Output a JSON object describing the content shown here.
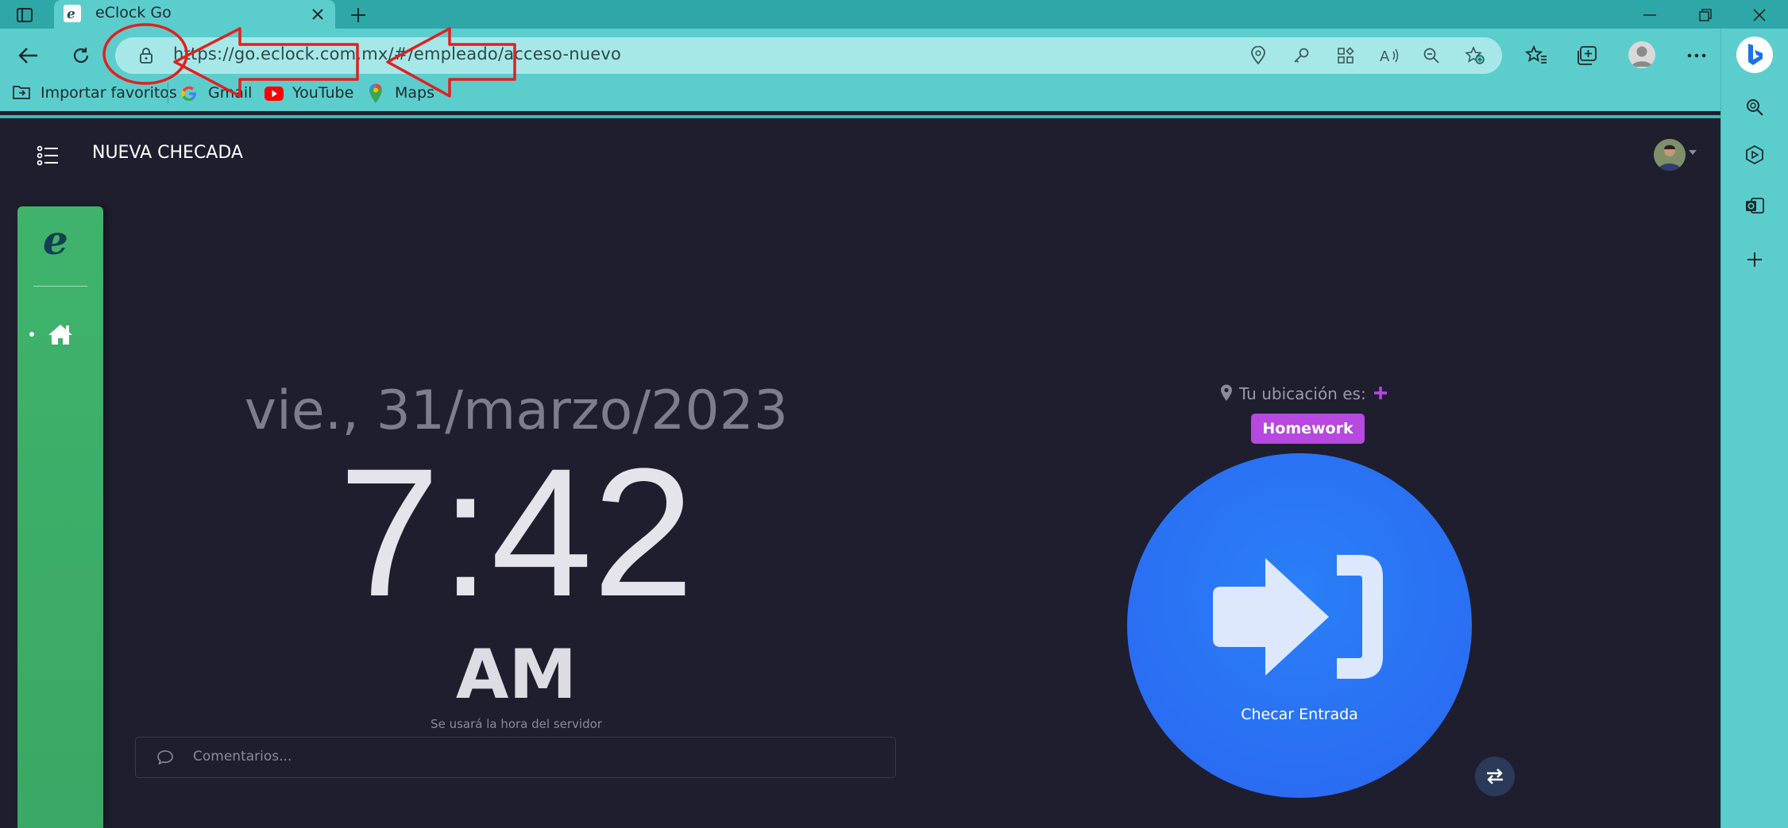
{
  "browser": {
    "tab_title": "eClock Go",
    "url": "https://go.eclock.com.mx/#/empleado/acceso-nuevo",
    "bookmarks": [
      {
        "label": "Importar favoritos"
      },
      {
        "label": "Gmail"
      },
      {
        "label": "YouTube"
      },
      {
        "label": "Maps"
      }
    ]
  },
  "app": {
    "page_title": "NUEVA CHECADA",
    "date": "vie., 31/marzo/2023",
    "time": "7:42",
    "ampm": "AM",
    "server_note": "Se usará la hora del servidor",
    "comment_placeholder": "Comentarios...",
    "location_label": "Tu ubicación es:",
    "location_badge": "Homework",
    "check_in_label": "Checar Entrada"
  },
  "colors": {
    "app_bg": "#1f1e2e",
    "browser_teal": "#5ccdcd",
    "sidebar_green": "#3fb36b",
    "primary_blue": "#2a6ef3",
    "badge_purple": "#b748e0",
    "annotation_red": "#e02020"
  }
}
